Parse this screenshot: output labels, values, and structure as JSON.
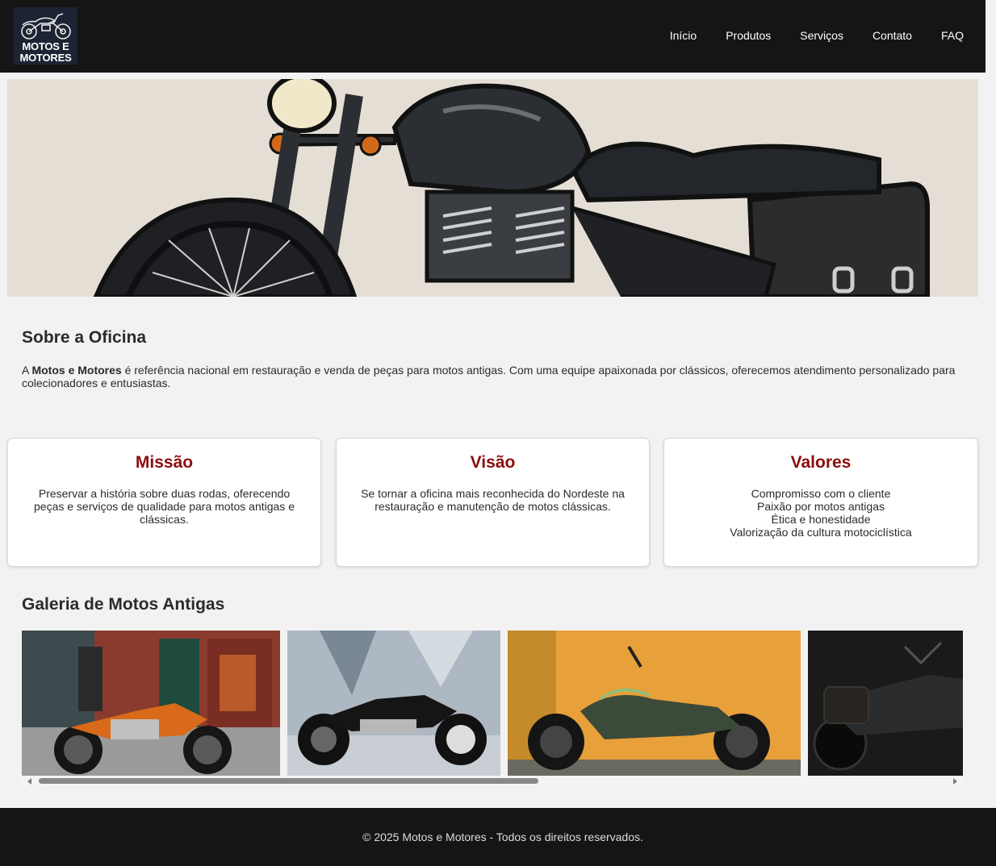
{
  "header": {
    "logo_text_line1": "MOTOS E",
    "logo_text_line2": "MOTORES",
    "nav": [
      "Início",
      "Produtos",
      "Serviços",
      "Contato",
      "FAQ"
    ]
  },
  "about": {
    "title": "Sobre a Oficina",
    "text_prefix": "A ",
    "text_bold": "Motos e Motores",
    "text_rest": " é referência nacional em restauração e venda de peças para motos antigas. Com uma equipe apaixonada por clássicos, oferecemos atendimento personalizado para colecionadores e entusiastas."
  },
  "cards": [
    {
      "title": "Missão",
      "text": "Preservar a história sobre duas rodas, oferecendo peças e serviços de qualidade para motos antigas e clássicas."
    },
    {
      "title": "Visão",
      "text": "Se tornar a oficina mais reconhecida do Nordeste na restauração e manutenção de motos clássicas."
    },
    {
      "title": "Valores",
      "lines": [
        "Compromisso com o cliente",
        "Paixão por motos antigas",
        "Ética e honestidade",
        "Valorização da cultura motociclística"
      ]
    }
  ],
  "gallery": {
    "title": "Galeria de Motos Antigas"
  },
  "footer": {
    "text": "© 2025 Motos e Motores - Todos os direitos reservados."
  },
  "colors": {
    "header_bg": "#151515",
    "accent": "#8b0d0d",
    "page_bg": "#f2f2f2"
  }
}
